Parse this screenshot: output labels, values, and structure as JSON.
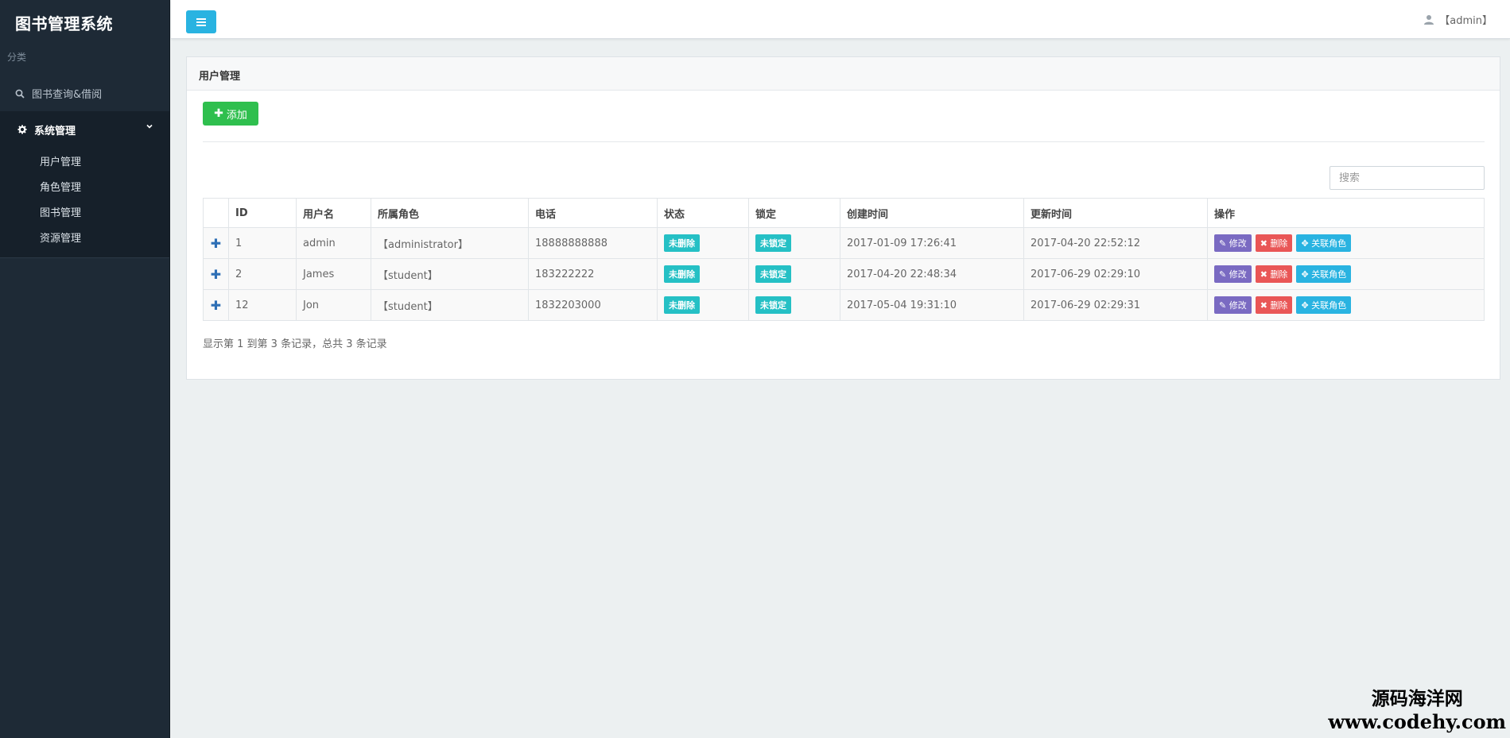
{
  "sidebar": {
    "title": "图书管理系统",
    "section_label": "分类",
    "search_item": "图书查询&借阅",
    "group": {
      "label": "系统管理",
      "items": [
        "用户管理",
        "角色管理",
        "图书管理",
        "资源管理"
      ]
    }
  },
  "topbar": {
    "user": "【admin】"
  },
  "panel": {
    "title": "用户管理",
    "add_label": "添加",
    "search_placeholder": "搜索",
    "columns": [
      "ID",
      "用户名",
      "所属角色",
      "电话",
      "状态",
      "锁定",
      "创建时间",
      "更新时间",
      "操作"
    ],
    "rows": [
      {
        "id": "1",
        "username": "admin",
        "role": "【administrator】",
        "phone": "18888888888",
        "status": "未删除",
        "lock": "未锁定",
        "created": "2017-01-09 17:26:41",
        "updated": "2017-04-20 22:52:12"
      },
      {
        "id": "2",
        "username": "James",
        "role": "【student】",
        "phone": "183222222",
        "status": "未删除",
        "lock": "未锁定",
        "created": "2017-04-20 22:48:34",
        "updated": "2017-06-29 02:29:10"
      },
      {
        "id": "12",
        "username": "Jon",
        "role": "【student】",
        "phone": "1832203000",
        "status": "未删除",
        "lock": "未锁定",
        "created": "2017-05-04 19:31:10",
        "updated": "2017-06-29 02:29:31"
      }
    ],
    "actions": {
      "edit": "修改",
      "delete": "删除",
      "role": "关联角色"
    },
    "summary": "显示第 1 到第 3 条记录，总共 3 条记录"
  },
  "watermark": {
    "line1": "源码海洋网",
    "line2": "www.codehy.com"
  },
  "colors": {
    "sidebar_bg": "#1e2a36",
    "accent_blue": "#29b3e1",
    "add_green": "#2fbf4e",
    "badge_teal": "#25c0c5",
    "edit_purple": "#7a6ac2",
    "delete_red": "#e95656"
  }
}
